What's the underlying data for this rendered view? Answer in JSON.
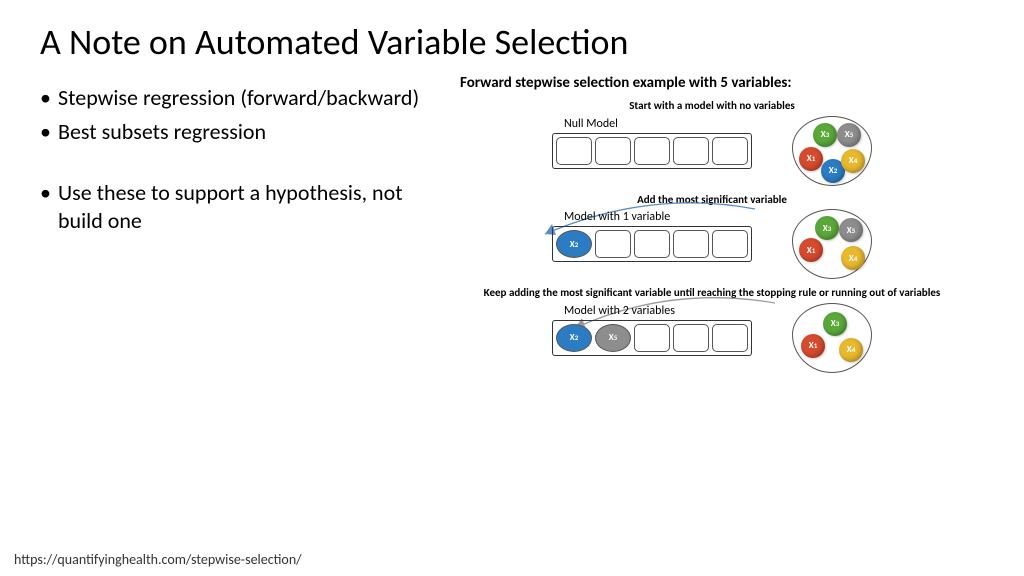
{
  "title": "A Note on Automated Variable Selection",
  "bullets": {
    "b1": "Stepwise regression (forward/backward)",
    "b2": "Best subsets regression",
    "b3": "Use these to support a hypothesis, not build one"
  },
  "diagram": {
    "title": "Forward stepwise selection example with 5 variables:",
    "step1": {
      "caption": "Start with a model with no variables",
      "label": "Null Model",
      "slots": [
        "",
        "",
        "",
        "",
        ""
      ],
      "pool": [
        {
          "name": "X1",
          "color": "c-red",
          "pos": "left:6px;top:30px;"
        },
        {
          "name": "X2",
          "color": "c-blue",
          "pos": "left:28px;top:42px;"
        },
        {
          "name": "X3",
          "color": "c-green",
          "pos": "left:20px;top:6px;"
        },
        {
          "name": "X4",
          "color": "c-yellow",
          "pos": "left:48px;top:32px;"
        },
        {
          "name": "X5",
          "color": "c-grey",
          "pos": "left:44px;top:6px;"
        }
      ]
    },
    "step2": {
      "caption": "Add the most significant variable",
      "label": "Model with 1 variable",
      "slots": [
        "X2",
        "",
        "",
        "",
        ""
      ],
      "slot_colors": [
        "c-blue",
        "",
        "",
        "",
        ""
      ],
      "pool": [
        {
          "name": "X1",
          "color": "c-red",
          "pos": "left:6px;top:28px;"
        },
        {
          "name": "X3",
          "color": "c-green",
          "pos": "left:22px;top:6px;"
        },
        {
          "name": "X4",
          "color": "c-yellow",
          "pos": "left:48px;top:36px;"
        },
        {
          "name": "X5",
          "color": "c-grey",
          "pos": "left:46px;top:8px;"
        }
      ]
    },
    "step3": {
      "caption": "Keep adding the most significant variable until reaching the stopping rule or running out of variables",
      "label": "Model with 2 variables",
      "slots": [
        "X2",
        "X5",
        "",
        "",
        ""
      ],
      "slot_colors": [
        "c-blue",
        "c-grey",
        "",
        "",
        ""
      ],
      "pool": [
        {
          "name": "X1",
          "color": "c-red",
          "pos": "left:8px;top:30px;"
        },
        {
          "name": "X3",
          "color": "c-green",
          "pos": "left:30px;top:8px;"
        },
        {
          "name": "X4",
          "color": "c-yellow",
          "pos": "left:46px;top:34px;"
        }
      ]
    }
  },
  "footer": "https://quantifyinghealth.com/stepwise-selection/"
}
